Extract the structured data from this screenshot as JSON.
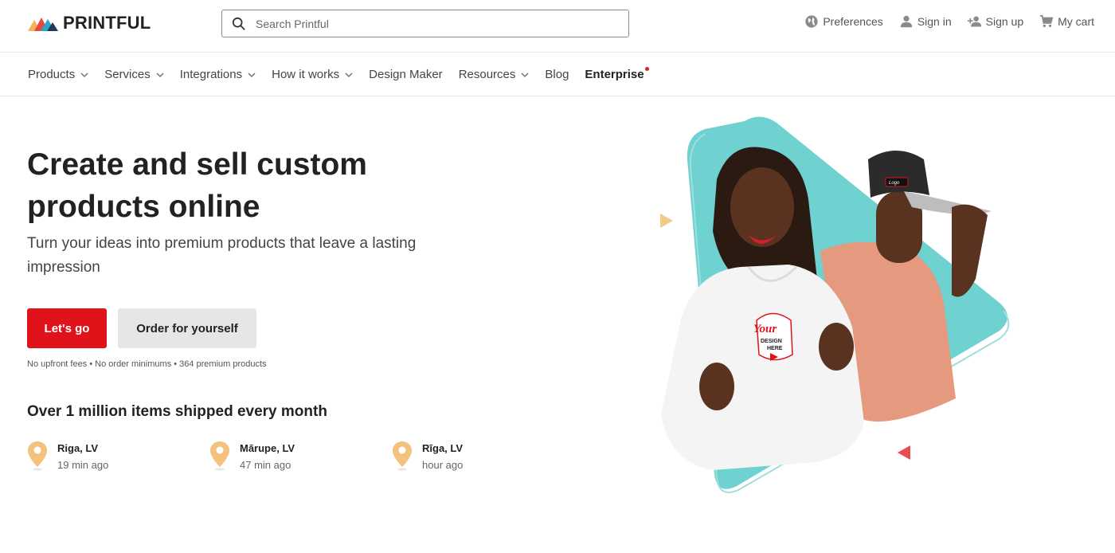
{
  "brand": {
    "name": "PRINTFUL"
  },
  "search": {
    "placeholder": "Search Printful"
  },
  "top_actions": [
    {
      "label": "Preferences",
      "icon": "globe-icon"
    },
    {
      "label": "Sign in",
      "icon": "user-icon"
    },
    {
      "label": "Sign up",
      "icon": "add-user-icon"
    },
    {
      "label": "My cart",
      "icon": "cart-icon"
    }
  ],
  "nav": [
    {
      "label": "Products",
      "dropdown": true
    },
    {
      "label": "Services",
      "dropdown": true
    },
    {
      "label": "Integrations",
      "dropdown": true
    },
    {
      "label": "How it works",
      "dropdown": true
    },
    {
      "label": "Design Maker",
      "dropdown": false
    },
    {
      "label": "Resources",
      "dropdown": true
    },
    {
      "label": "Blog",
      "dropdown": false
    },
    {
      "label": "Enterprise",
      "dropdown": false,
      "badge": "new-dot"
    }
  ],
  "hero": {
    "title": "Create and sell custom products online",
    "subtitle": "Turn your ideas into premium products that leave a lasting impression",
    "primary_cta": "Let's go",
    "secondary_cta": "Order for yourself",
    "fineprint": "No upfront fees • No order minimums • 364 premium products"
  },
  "shipping": {
    "heading": "Over 1 million items shipped every month",
    "recent": [
      {
        "city": "Riga, LV",
        "time": "19 min ago"
      },
      {
        "city": "Mārupe, LV",
        "time": "47 min ago"
      },
      {
        "city": "Rīga, LV",
        "time": "hour ago"
      }
    ]
  },
  "hero_image": {
    "hoodie_print": [
      "Your",
      "DESIGN",
      "HERE"
    ],
    "cap_patch": "Logo"
  },
  "colors": {
    "accent_red": "#e0131a",
    "teal": "#6fd1d0",
    "pin": "#f2c27e",
    "triangle_orange": "#f4c98a",
    "triangle_red": "#e94b55"
  }
}
